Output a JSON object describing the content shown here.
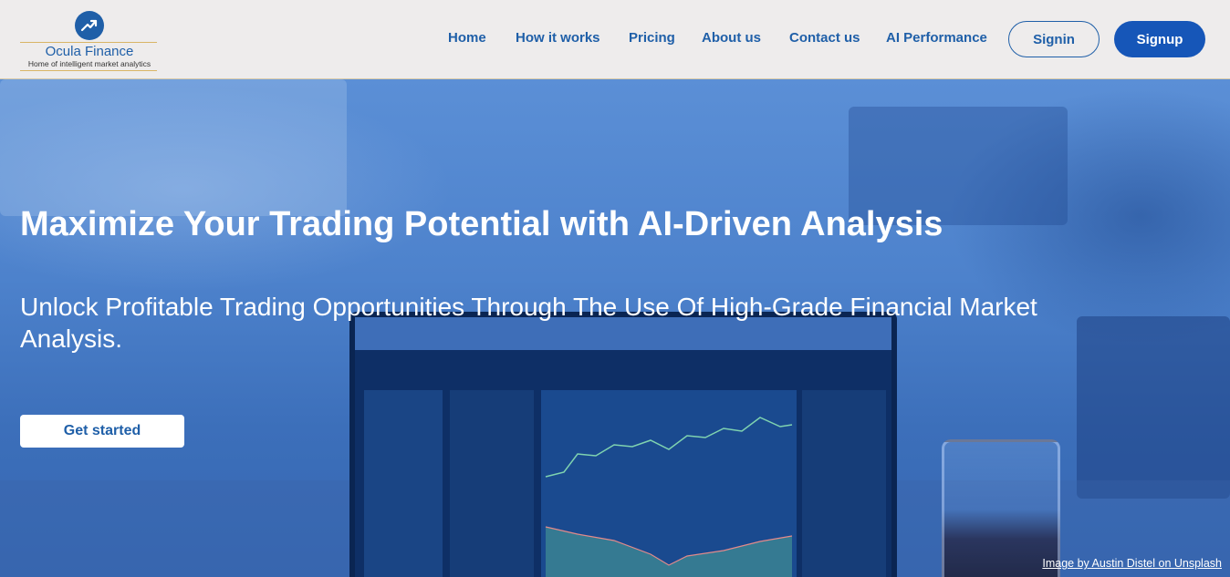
{
  "brand": {
    "name": "Ocula Finance",
    "tagline": "Home of intelligent market analytics",
    "logo_icon": "trend-up-arrow-icon",
    "accent": "#1f5fa8"
  },
  "nav": {
    "items": [
      {
        "label": "Home"
      },
      {
        "label": "How it works"
      },
      {
        "label": "Pricing"
      },
      {
        "label": "About us"
      },
      {
        "label": "Contact us"
      },
      {
        "label": "AI Performance"
      }
    ],
    "signin_label": "Signin",
    "signup_label": "Signup"
  },
  "hero": {
    "title": "Maximize Your Trading Potential with AI-Driven Analysis",
    "subtitle": "Unlock Profitable Trading Opportunities Through The Use Of High-Grade Financial Market Analysis.",
    "cta_label": "Get started",
    "credit": "Image by Austin Distel on Unsplash"
  }
}
